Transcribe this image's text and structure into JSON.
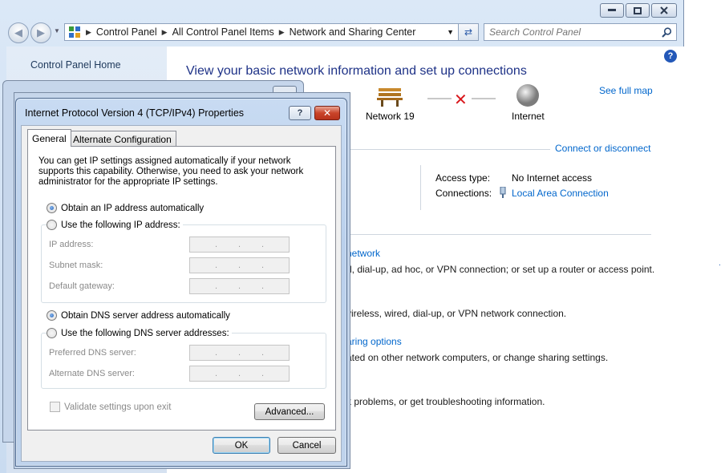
{
  "main_window": {
    "breadcrumb": [
      "Control Panel",
      "All Control Panel Items",
      "Network and Sharing Center"
    ],
    "search_placeholder": "Search Control Panel",
    "left_pane": {
      "home_link": "Control Panel Home"
    },
    "content": {
      "title": "View your basic network information and set up connections",
      "see_full_map": "See full map",
      "network_node": "Network  19",
      "internet_node": "Internet",
      "connect_or_disconnect": "Connect or disconnect",
      "access_type_label": "Access type:",
      "access_type_value": "No Internet access",
      "connections_label": "Connections:",
      "connections_value": "Local Area Connection",
      "tasks": [
        {
          "link": "network",
          "desc": "d, dial-up, ad hoc, or VPN connection; or set up a router or access point."
        },
        {
          "link": "",
          "desc": "vireless, wired, dial-up, or VPN network connection."
        },
        {
          "link": "aring options",
          "desc": "ated on other network computers, or change sharing settings."
        },
        {
          "link": "",
          "desc": "k problems, or get troubleshooting information."
        }
      ]
    }
  },
  "dialog": {
    "title": "Internet Protocol Version 4 (TCP/IPv4) Properties",
    "help_label": "?",
    "tabs": [
      "General",
      "Alternate Configuration"
    ],
    "description": "You can get IP settings assigned automatically if your network supports this capability. Otherwise, you need to ask your network administrator for the appropriate IP settings.",
    "ip_auto": "Obtain an IP address automatically",
    "ip_manual": "Use the following IP address:",
    "ip_address_label": "IP address:",
    "subnet_mask_label": "Subnet mask:",
    "default_gateway_label": "Default gateway:",
    "dns_auto": "Obtain DNS server address automatically",
    "dns_manual": "Use the following DNS server addresses:",
    "preferred_dns_label": "Preferred DNS server:",
    "alternate_dns_label": "Alternate DNS server:",
    "validate_label": "Validate settings upon exit",
    "advanced_button": "Advanced...",
    "ok_button": "OK",
    "cancel_button": "Cancel"
  }
}
